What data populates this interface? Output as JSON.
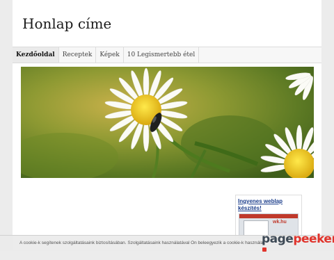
{
  "site": {
    "title": "Honlap címe"
  },
  "nav": {
    "items": [
      {
        "label": "Kezdőoldal",
        "active": true
      },
      {
        "label": "Receptek",
        "active": false
      },
      {
        "label": "Képek",
        "active": false
      },
      {
        "label": "10 Legismertebb étel",
        "active": false
      }
    ]
  },
  "ad": {
    "title": "Ingyenes weblap készítés!",
    "thumb_brand": "wk.hu"
  },
  "cookie": {
    "text": "A cookie-k segítenek szolgáltatásaink biztosításában. Szolgáltatásaink használatával Ön beleegyezik a cookie-k használatába."
  },
  "watermark": {
    "part1": "page",
    "part2": "peeker"
  },
  "colors": {
    "accent": "#e0342c",
    "banner_green": "#7a8f2e",
    "daisy_center": "#f2d21b"
  }
}
